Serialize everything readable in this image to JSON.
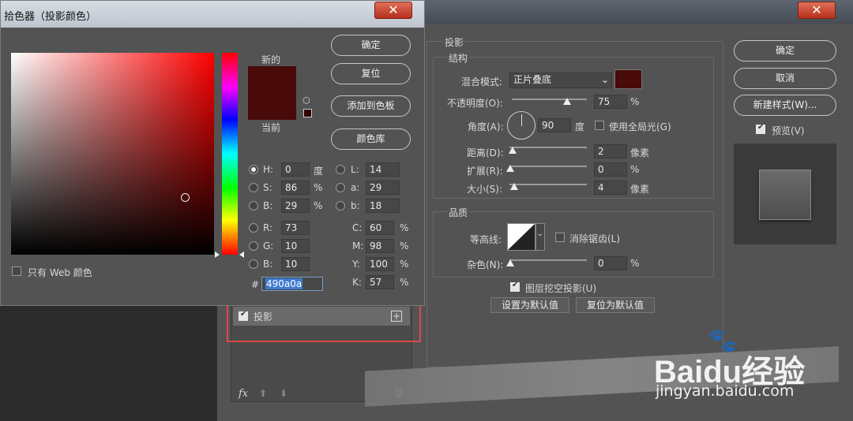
{
  "layer_style_dialog": {
    "section_title": "投影",
    "structure_title": "结构",
    "blend_mode_label": "混合模式:",
    "blend_mode_value": "正片叠底",
    "shadow_color": "#490a0a",
    "opacity_label": "不透明度(O):",
    "opacity_value": "75",
    "angle_label": "角度(A):",
    "angle_value": "90",
    "degree_unit": "度",
    "global_light_label": "使用全局光(G)",
    "distance_label": "距离(D):",
    "distance_value": "2",
    "spread_label": "扩展(R):",
    "spread_value": "0",
    "size_label": "大小(S):",
    "size_value": "4",
    "pixel_unit": "像素",
    "percent_unit": "%",
    "quality_title": "品质",
    "contour_label": "等高线:",
    "antialias_label": "消除锯齿(L)",
    "noise_label": "杂色(N):",
    "noise_value": "0",
    "knockout_label": "图层挖空投影(U)",
    "set_default_button": "设置为默认值",
    "reset_default_button": "复位为默认值",
    "ok_button": "确定",
    "cancel_button": "取消",
    "new_style_button": "新建样式(W)...",
    "preview_label": "预览(V)",
    "fx_label": "fx",
    "effect_item_label": "投影"
  },
  "color_picker": {
    "title": "拾色器（投影颜色）",
    "new_label": "新的",
    "current_label": "当前",
    "ok_button": "确定",
    "reset_button": "复位",
    "add_swatch_button": "添加到色板",
    "color_library_button": "颜色库",
    "web_only_label": "只有 Web 颜色",
    "current_color": "#490a0a",
    "hue_color": "#ff0000",
    "fields": {
      "H": {
        "label": "H:",
        "value": "0",
        "unit": "度"
      },
      "S": {
        "label": "S:",
        "value": "86",
        "unit": "%"
      },
      "Bv": {
        "label": "B:",
        "value": "29",
        "unit": "%"
      },
      "R": {
        "label": "R:",
        "value": "73"
      },
      "G": {
        "label": "G:",
        "value": "10"
      },
      "B": {
        "label": "B:",
        "value": "10"
      },
      "L": {
        "label": "L:",
        "value": "14"
      },
      "a": {
        "label": "a:",
        "value": "29"
      },
      "b": {
        "label": "b:",
        "value": "18"
      },
      "C": {
        "label": "C:",
        "value": "60",
        "unit": "%"
      },
      "M": {
        "label": "M:",
        "value": "98",
        "unit": "%"
      },
      "Y": {
        "label": "Y:",
        "value": "100",
        "unit": "%"
      },
      "K": {
        "label": "K:",
        "value": "57",
        "unit": "%"
      }
    },
    "hex_prefix": "#",
    "hex_value": "490a0a"
  },
  "watermark": {
    "brand": "Baidu经验",
    "url": "jingyan.baidu.com"
  },
  "highlight_color": "#e04848"
}
